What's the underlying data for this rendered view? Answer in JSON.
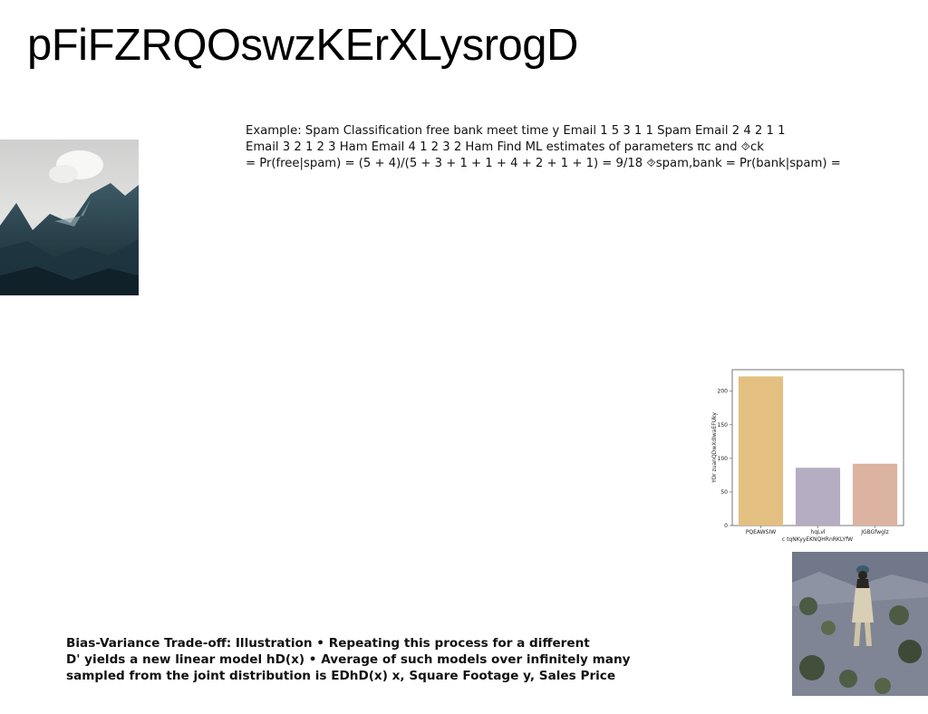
{
  "slide": {
    "title": "pFiFZRQOswzKErXLysrogD",
    "example_lines": [
      "Example: Spam Classification free bank meet time y Email 1 5 3 1 1 Spam Email 2 4 2 1 1",
      "Email 3 2 1 2 3 Ham Email 4 1 2 3 2 Ham Find ML estimates of parameters πc and ⯑ck",
      "= Pr(free|spam) = (5 + 4)/(5 + 3 + 1 + 1 + 4 + 2 + 1 + 1) = 9/18 ⯑spam,bank = Pr(bank|spam) ="
    ],
    "bias_lines": [
      "Bias-Variance Trade-off: Illustration • Repeating this process for a different",
      "D' yields a new linear model hD(x) • Average of such models over infinitely many",
      "sampled from the joint distribution is EDhD(x) x, Square Footage y, Sales Price"
    ]
  },
  "chart_data": {
    "type": "bar",
    "categories": [
      "PQEAWSIW",
      "hqLvl",
      "JGBGfwglz"
    ],
    "values": [
      222,
      86,
      92
    ],
    "colors": [
      "#e3bf82",
      "#b5adc2",
      "#dbb3a0"
    ],
    "xlabel": "c tqNKyyEKNQHRnRKLYfW",
    "ylabel": "YOr zuanQDwXdIwaEFUky",
    "yticks": [
      0,
      50,
      100,
      150,
      200
    ],
    "ylim": [
      0,
      232
    ],
    "grid": false
  }
}
